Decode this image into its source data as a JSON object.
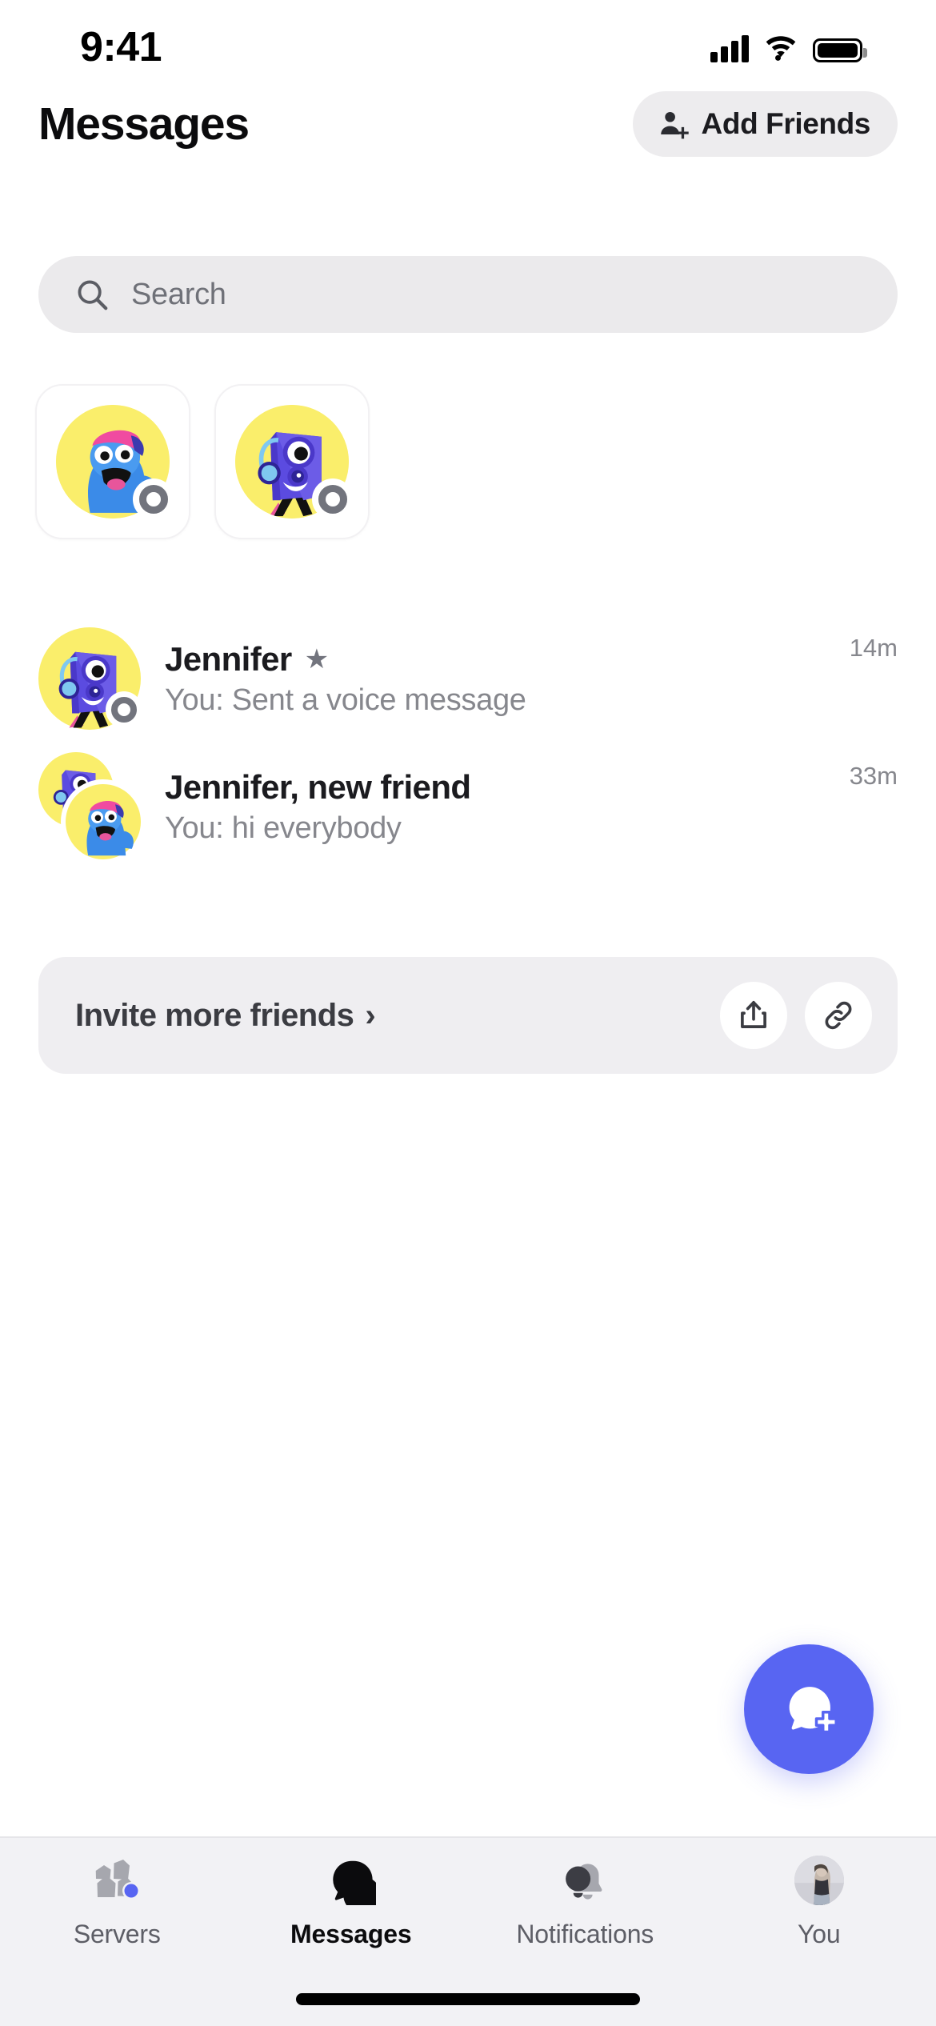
{
  "status_bar": {
    "time": "9:41",
    "signal_icon": "cellular-signal-icon",
    "wifi_icon": "wifi-icon",
    "battery_icon": "battery-icon"
  },
  "header": {
    "title": "Messages",
    "add_friends_label": "Add Friends",
    "add_friends_icon": "person-add-icon"
  },
  "search": {
    "placeholder": "Search",
    "icon": "search-icon"
  },
  "stories": [
    {
      "name": "story-card-1",
      "character": "blue-creature-pink-cap",
      "status": "offline"
    },
    {
      "name": "story-card-2",
      "character": "purple-speaker-headphones",
      "status": "offline"
    }
  ],
  "conversations": [
    {
      "name": "Jennifer",
      "favorite": true,
      "favorite_icon": "star-icon",
      "preview": "You: Sent a voice message",
      "time": "14m",
      "avatar": "purple-speaker-headphones",
      "group": false
    },
    {
      "name": "Jennifer, new friend",
      "favorite": false,
      "preview": "You: hi everybody",
      "time": "33m",
      "avatar": "group-stacked",
      "group": true
    }
  ],
  "invite_card": {
    "label": "Invite more friends",
    "chevron": "›",
    "share_icon": "share-icon",
    "link_icon": "link-icon"
  },
  "fab": {
    "icon": "new-message-icon",
    "color": "#5865F2"
  },
  "tab_bar": {
    "active": "Messages",
    "items": [
      {
        "label": "Servers",
        "icon": "servers-icon",
        "badge": true,
        "badge_color": "#5865F2",
        "active": false
      },
      {
        "label": "Messages",
        "icon": "chat-bubble-icon",
        "badge": false,
        "active": true
      },
      {
        "label": "Notifications",
        "icon": "bell-icon",
        "badge": false,
        "active": false
      },
      {
        "label": "You",
        "icon": "user-avatar-icon",
        "badge": false,
        "active": false
      }
    ]
  },
  "colors": {
    "accent": "#5865F2",
    "search_bg": "#EBEAEC",
    "card_bg": "#EFEEF1",
    "tabbar_bg": "#F2F2F5",
    "muted_text": "#86878D",
    "avatar_yellow": "#FAEE6B"
  }
}
